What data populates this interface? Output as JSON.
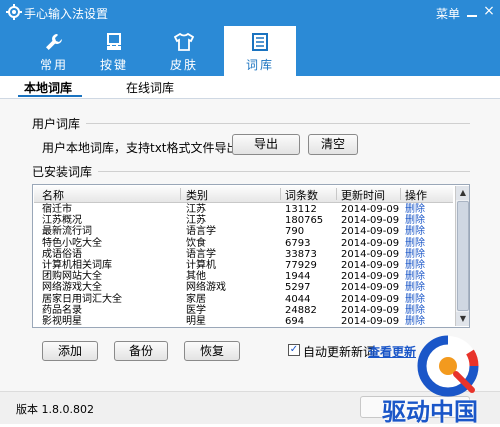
{
  "window": {
    "title": "手心输入法设置",
    "menu_label": "菜单",
    "close_glyph": "×"
  },
  "tabs": [
    {
      "label": "常用",
      "icon": "wrench-icon"
    },
    {
      "label": "按键",
      "icon": "keyboard-icon"
    },
    {
      "label": "皮肤",
      "icon": "shirt-icon"
    },
    {
      "label": "词库",
      "icon": "document-icon",
      "active": true
    }
  ],
  "subnav": {
    "local": "本地词库",
    "online": "在线词库"
  },
  "user_dict": {
    "section_title": "用户词库",
    "description": "用户本地词库，支持txt格式文件导出",
    "export_label": "导出",
    "clear_label": "清空"
  },
  "installed": {
    "section_title": "已安装词库",
    "columns": [
      "名称",
      "类别",
      "词条数",
      "更新时间",
      "操作"
    ],
    "rows": [
      {
        "name": "宿迁市",
        "category": "江苏",
        "count": "13112",
        "date": "2014-09-09",
        "action": "删除"
      },
      {
        "name": "江苏概况",
        "category": "江苏",
        "count": "180765",
        "date": "2014-09-09",
        "action": "删除"
      },
      {
        "name": "最新流行词",
        "category": "语言学",
        "count": "790",
        "date": "2014-09-09",
        "action": "删除"
      },
      {
        "name": "特色小吃大全",
        "category": "饮食",
        "count": "6793",
        "date": "2014-09-09",
        "action": "删除"
      },
      {
        "name": "成语俗语",
        "category": "语言学",
        "count": "33873",
        "date": "2014-09-09",
        "action": "删除"
      },
      {
        "name": "计算机相关词库",
        "category": "计算机",
        "count": "77929",
        "date": "2014-09-09",
        "action": "删除"
      },
      {
        "name": "团购网站大全",
        "category": "其他",
        "count": "1944",
        "date": "2014-09-09",
        "action": "删除"
      },
      {
        "name": "网络游戏大全",
        "category": "网络游戏",
        "count": "5297",
        "date": "2014-09-09",
        "action": "删除"
      },
      {
        "name": "居家日用词汇大全",
        "category": "家居",
        "count": "4044",
        "date": "2014-09-09",
        "action": "删除"
      },
      {
        "name": "药品名录",
        "category": "医学",
        "count": "24882",
        "date": "2014-09-09",
        "action": "删除"
      },
      {
        "name": "影视明星",
        "category": "明星",
        "count": "694",
        "date": "2014-09-09",
        "action": "删除"
      }
    ],
    "add_label": "添加",
    "backup_label": "备份",
    "restore_label": "恢复",
    "auto_update_label": "自动更新新词",
    "auto_update_checked": true,
    "view_update_label": "查看更新"
  },
  "footer": {
    "version": "版本 1.8.0.802"
  },
  "watermark": {
    "text": "驱动中国"
  },
  "colors": {
    "accent": "#2b8ad6",
    "link": "#1a56c8"
  }
}
